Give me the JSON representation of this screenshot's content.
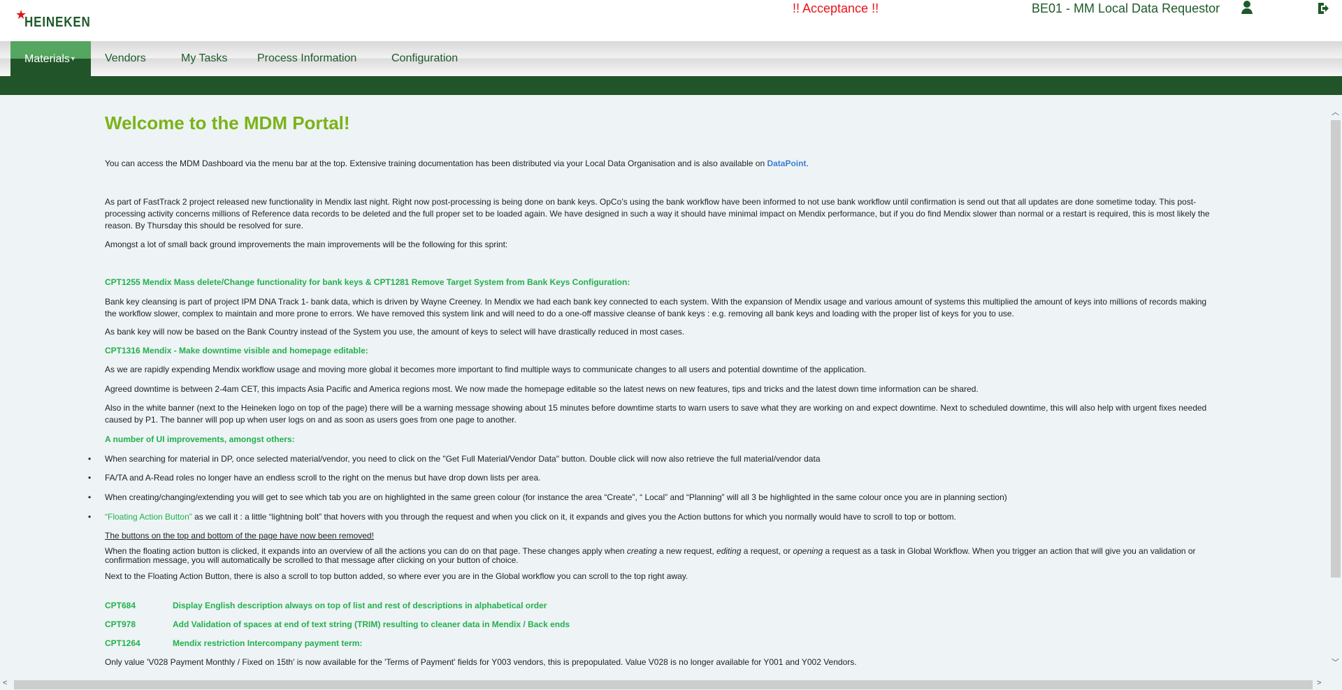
{
  "header": {
    "logo_text": "HEINEKEN",
    "environment_banner": "!! Acceptance !!",
    "role": "BE01 - MM Local Data Requestor",
    "icons": [
      "user-icon",
      "logout-icon"
    ]
  },
  "nav": {
    "items": [
      {
        "label": "Materials",
        "active": true
      },
      {
        "label": "Vendors"
      },
      {
        "label": "My Tasks"
      },
      {
        "label": "Process Information"
      },
      {
        "label": "Configuration"
      }
    ]
  },
  "main": {
    "title": "Welcome to the MDM Portal!",
    "intro": "You can access the MDM Dashboard via the menu bar at the top. Extensive training documentation has been distributed via your Local Data Organisation and is also available on ",
    "intro_link": "DataPoint",
    "intro_end": ".",
    "p1": "As part of FastTrack 2 project released new functionality in Mendix last night. Right now post-processing is being done on bank keys. OpCo’s using the bank workflow have been informed to not use bank workflow until confirmation is send out that all updates are done sometime today. This post-processing activity concerns millions of Reference data records to be deleted and the full proper set to be loaded again. We have designed in such a way it should have minimal impact on Mendix performance, but if you do find Mendix slower than normal or a restart is required, this is most likely the reason. By Thursday this should be resolved for sure.",
    "p2": "Amongst a lot of small back ground improvements the main improvements will be the following for this sprint:",
    "h_cpt1255": "CPT1255   Mendix Mass delete/Change functionality for bank keys & CPT1281 Remove Target System from Bank Keys Configuration",
    "h_cpt1255_colon": ":",
    "p3": "Bank key cleansing is part of project IPM DNA Track 1- bank data, which is driven by Wayne Creeney. In Mendix we had each bank key connected to each system. With the expansion of Mendix usage and various amount of systems this multiplied the amount of keys into millions of records making the workflow slower, complex to maintain and more prone to errors. We have removed this system link and will need to do a one-off massive cleanse of bank keys : e.g. removing all bank keys and loading with the proper list of keys for you to use.",
    "p4": "As bank key will now be based on the Bank Country instead of the System you use, the amount of keys to select will have drastically reduced in most cases.",
    "h_cpt1316": "CPT1316  Mendix - Make downtime visible and homepage editable:",
    "p5": "As we are rapidly expending Mendix workflow usage and moving more global it becomes more important to find multiple ways to communicate changes to all users and potential downtime of the application.",
    "p6": "Agreed downtime is between 2-4am CET, this impacts Asia Pacific and America regions most. We now made the homepage editable so the latest news on new features, tips and tricks and the latest down time information can be shared.",
    "p7": "Also in the white banner (next to the Heineken logo on top of the page) there will be a warning message showing about 15 minutes before downtime starts to warn users to save what they are working on and expect downtime. Next to scheduled downtime, this will also help with urgent fixes needed caused by P1. The banner will pop up when user logs on and as soon as users goes from one page to another.",
    "h_ui": "A number of UI improvements, amongst others:",
    "bullets": [
      "When searching for material in DP, once selected material/vendor, you need to click on the \"Get Full Material/Vendor Data\" button. Double click will now also retrieve the full material/vendor data",
      "FA/TA and A-Read roles no longer have an endless scroll to the right on the menus but have drop down lists per area.",
      "When creating/changing/extending you will get to see which tab you are on highlighted in the same green colour (for instance the area “Create”, “ Local” and  “Planning” will all 3 be highlighted in the same colour once you are in planning section)"
    ],
    "fab_label": "“Floating Action Button”",
    "fab_text": " as we call it :  a little “lightning bolt” that hovers with you through the request and when you click on it, it expands and gives you the Action buttons for which you normally would have to scroll to top or bottom.",
    "removed": "The buttons on the top and bottom of the page have now been removed!",
    "fab_p1": "When the floating action button is clicked, it expands into an overview of all the actions you can do on that page. These changes apply when ",
    "fab_creating": "creating",
    "fab_p2": " a new request, ",
    "fab_editing": "editing",
    "fab_p3": " a request, or ",
    "fab_opening": "opening",
    "fab_p4": " a request as a task in Global Workflow. When you trigger an action that will give you an validation or confirmation message, you will automatically be scrolled to that message after clicking on your button of choice.",
    "fab_next": "Next to the Floating Action Button, there is also a scroll to top button added, so where ever you are in the Global workflow you can scroll to the top right away.",
    "items": [
      {
        "code": "CPT684",
        "text": "Display English description always on top of list and rest of descriptions in alphabetical order"
      },
      {
        "code": "CPT978",
        "text": "Add Validation of spaces at end of text string (TRIM) resulting to cleaner data in Mendix / Back ends"
      },
      {
        "code": "CPT1264",
        "text": "Mendix restriction Intercompany payment term:"
      }
    ],
    "last": "Only value 'V028 Payment Monthly / Fixed on 15th' is now available for the 'Terms of Payment' fields for Y003 vendors, this is prepopulated. Value V028 is no longer available for Y001 and Y002 Vendors."
  }
}
